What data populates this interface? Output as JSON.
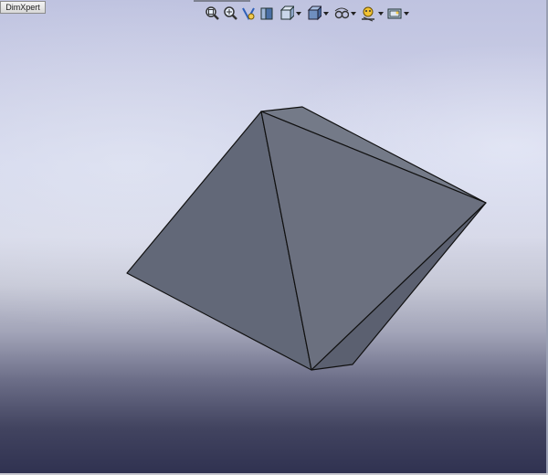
{
  "tabs": {
    "dimxpert": "DimXpert"
  },
  "heads_up_toolbar": {
    "tools": [
      {
        "name": "zoom-to-fit-icon"
      },
      {
        "name": "zoom-to-area-icon"
      },
      {
        "name": "previous-view-icon"
      },
      {
        "name": "section-view-icon"
      },
      {
        "name": "view-orientation-icon",
        "dropdown": true
      },
      {
        "name": "display-style-icon",
        "dropdown": true
      },
      {
        "name": "hide-show-items-icon",
        "dropdown": true
      },
      {
        "name": "edit-appearance-icon",
        "dropdown": true
      },
      {
        "name": "apply-scene-icon",
        "dropdown": true
      }
    ]
  },
  "colors": {
    "part_face_left": "#626878",
    "part_face_front": "#6b707f",
    "part_face_right": "#5d6271",
    "edge": "#101010"
  }
}
